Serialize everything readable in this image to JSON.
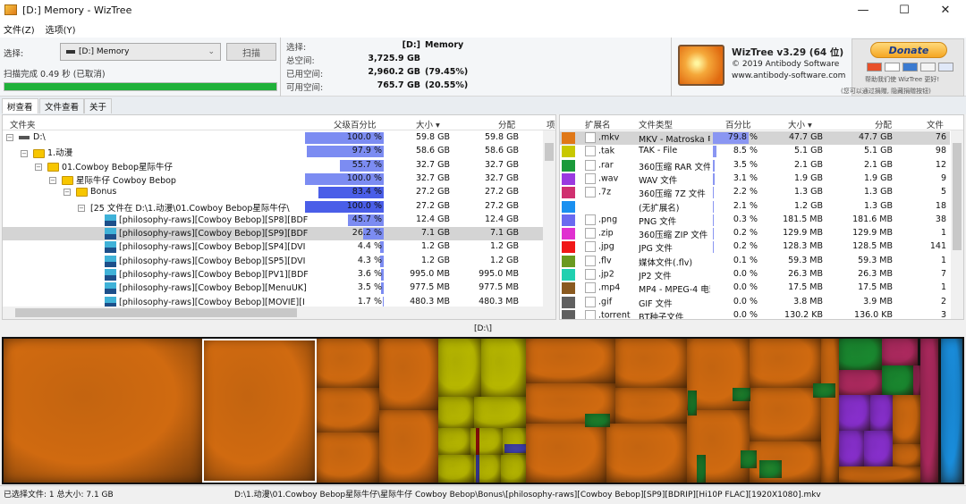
{
  "window": {
    "title": "[D:] Memory  - WizTree",
    "minimize": "—",
    "maximize": "☐",
    "close": "✕"
  },
  "menu": [
    {
      "label": "文件(Z)"
    },
    {
      "label": "选项(Y)"
    }
  ],
  "toolbar": {
    "select_label": "选择:",
    "drive_value": "[D:] Memory",
    "scan_label": "扫描",
    "scan_status": "扫描完成 0.49 秒 (已取消)",
    "progress_percent": 100,
    "progress_color": "#1fb13a"
  },
  "drive_info": {
    "select_label": "选择:",
    "select_value": "[D:]",
    "select_name": "Memory",
    "total_label": "总空间:",
    "total_value": "3,725.9 GB",
    "used_label": "已用空间:",
    "used_value": "2,960.2 GB",
    "used_pct": "(79.45%)",
    "free_label": "可用空间:",
    "free_value": "765.7 GB",
    "free_pct": "(20.55%)"
  },
  "about": {
    "title": "WizTree v3.29 (64 位)",
    "copyright": "© 2019 Antibody Software",
    "url": "www.antibody-software.com"
  },
  "donate": {
    "label": "Donate",
    "note1": "帮助我们使 WizTree 更好!",
    "note2": "(您可以通过捐赠, 隐藏捐赠按钮)"
  },
  "tabs": [
    {
      "label": "树查看",
      "active": true
    },
    {
      "label": "文件查看"
    },
    {
      "label": "关于"
    }
  ],
  "tree": {
    "headers": {
      "name": "文件夹",
      "pct": "父级百分比",
      "size": "大小 ▾",
      "alloc": "分配",
      "items": "项"
    },
    "rows": [
      {
        "name": "D:\\",
        "pct": "100.0 %",
        "pct_value": 100,
        "size": "59.8 GB",
        "alloc": "59.8 GB",
        "depth": 0,
        "icon": "drive-icon"
      },
      {
        "name": "1.动漫",
        "pct": "97.9 %",
        "pct_value": 97.9,
        "size": "58.6 GB",
        "alloc": "58.6 GB",
        "depth": 1,
        "icon": "folder-icon"
      },
      {
        "name": "01.Cowboy Bebop星际牛仔",
        "pct": "55.7 %",
        "pct_value": 55.7,
        "size": "32.7 GB",
        "alloc": "32.7 GB",
        "depth": 2,
        "icon": "folder-icon"
      },
      {
        "name": "星际牛仔 Cowboy Bebop",
        "pct": "100.0 %",
        "pct_value": 100,
        "size": "32.7 GB",
        "alloc": "32.7 GB",
        "depth": 3,
        "icon": "folder-icon"
      },
      {
        "name": "Bonus",
        "pct": "83.4 %",
        "pct_value": 83.4,
        "size": "27.2 GB",
        "alloc": "27.2 GB",
        "depth": 4,
        "icon": "folder-icon"
      },
      {
        "name": "[25 文件在 D:\\1.动漫\\01.Cowboy Bebop星际牛仔\\",
        "pct": "100.0 %",
        "pct_value": 100,
        "size": "27.2 GB",
        "alloc": "27.2 GB",
        "depth": 5,
        "icon": "none"
      },
      {
        "name": "[philosophy-raws][Cowboy Bebop][SP8][BDF",
        "pct": "45.7 %",
        "pct_value": 45.7,
        "size": "12.4 GB",
        "alloc": "12.4 GB",
        "depth": 6,
        "icon": "mkv-icon"
      },
      {
        "name": "[philosophy-raws][Cowboy Bebop][SP9][BDF",
        "pct": "26.2 %",
        "pct_value": 26.2,
        "size": "7.1 GB",
        "alloc": "7.1 GB",
        "depth": 6,
        "icon": "mkv-icon",
        "selected": true
      },
      {
        "name": "[philosophy-raws][Cowboy Bebop][SP4][DVI",
        "pct": "4.4 %",
        "pct_value": 4.4,
        "size": "1.2 GB",
        "alloc": "1.2 GB",
        "depth": 6,
        "icon": "mkv-icon"
      },
      {
        "name": "[philosophy-raws][Cowboy Bebop][SP5][DVI",
        "pct": "4.3 %",
        "pct_value": 4.3,
        "size": "1.2 GB",
        "alloc": "1.2 GB",
        "depth": 6,
        "icon": "mkv-icon"
      },
      {
        "name": "[philosophy-raws][Cowboy Bebop][PV1][BDF",
        "pct": "3.6 %",
        "pct_value": 3.6,
        "size": "995.0 MB",
        "alloc": "995.0 MB",
        "depth": 6,
        "icon": "mkv-icon"
      },
      {
        "name": "[philosophy-raws][Cowboy Bebop][MenuUK]",
        "pct": "3.5 %",
        "pct_value": 3.5,
        "size": "977.5 MB",
        "alloc": "977.5 MB",
        "depth": 6,
        "icon": "mkv-icon"
      },
      {
        "name": "[philosophy-raws][Cowboy Bebop][MOVIE][I",
        "pct": "1.7 %",
        "pct_value": 1.7,
        "size": "480.3 MB",
        "alloc": "480.3 MB",
        "depth": 6,
        "icon": "mkv-icon"
      }
    ]
  },
  "extensions": {
    "headers": {
      "ext": "扩展名",
      "type": "文件类型",
      "pct": "百分比",
      "size": "大小 ▾",
      "alloc": "分配",
      "files": "文件"
    },
    "rows": [
      {
        "color": "#e07818",
        "ext": ".mkv",
        "type": "MKV - Matroska 电",
        "pct": "79.8 %",
        "pct_value": 79.8,
        "size": "47.7 GB",
        "alloc": "47.7 GB",
        "files": "76",
        "selected": true
      },
      {
        "color": "#c8c800",
        "ext": ".tak",
        "type": "TAK - File",
        "pct": "8.5 %",
        "pct_value": 8.5,
        "size": "5.1 GB",
        "alloc": "5.1 GB",
        "files": "98"
      },
      {
        "color": "#1a9a3a",
        "ext": ".rar",
        "type": "360压缩 RAR 文件",
        "pct": "3.5 %",
        "pct_value": 3.5,
        "size": "2.1 GB",
        "alloc": "2.1 GB",
        "files": "12"
      },
      {
        "color": "#9a3ae0",
        "ext": ".wav",
        "type": "WAV 文件",
        "pct": "3.1 %",
        "pct_value": 3.1,
        "size": "1.9 GB",
        "alloc": "1.9 GB",
        "files": "9"
      },
      {
        "color": "#d03070",
        "ext": ".7z",
        "type": "360压缩 7Z 文件",
        "pct": "2.2 %",
        "pct_value": 2.2,
        "size": "1.3 GB",
        "alloc": "1.3 GB",
        "files": "5"
      },
      {
        "color": "#1a90f0",
        "ext": "",
        "type": "(无扩展名)",
        "pct": "2.1 %",
        "pct_value": 2.1,
        "size": "1.2 GB",
        "alloc": "1.3 GB",
        "files": "18"
      },
      {
        "color": "#6a6af0",
        "ext": ".png",
        "type": "PNG 文件",
        "pct": "0.3 %",
        "pct_value": 0.3,
        "size": "181.5 MB",
        "alloc": "181.6 MB",
        "files": "38"
      },
      {
        "color": "#e030d0",
        "ext": ".zip",
        "type": "360压缩 ZIP 文件",
        "pct": "0.2 %",
        "pct_value": 0.2,
        "size": "129.9 MB",
        "alloc": "129.9 MB",
        "files": "1"
      },
      {
        "color": "#f01818",
        "ext": ".jpg",
        "type": "JPG 文件",
        "pct": "0.2 %",
        "pct_value": 0.2,
        "size": "128.3 MB",
        "alloc": "128.5 MB",
        "files": "141"
      },
      {
        "color": "#6a9a20",
        "ext": ".flv",
        "type": "媒体文件(.flv)",
        "pct": "0.1 %",
        "pct_value": 0.1,
        "size": "59.3 MB",
        "alloc": "59.3 MB",
        "files": "1"
      },
      {
        "color": "#20d0b0",
        "ext": ".jp2",
        "type": "JP2 文件",
        "pct": "0.0 %",
        "pct_value": 0,
        "size": "26.3 MB",
        "alloc": "26.3 MB",
        "files": "7"
      },
      {
        "color": "#8a5a20",
        "ext": ".mp4",
        "type": "MP4 - MPEG-4 电影",
        "pct": "0.0 %",
        "pct_value": 0,
        "size": "17.5 MB",
        "alloc": "17.5 MB",
        "files": "1"
      },
      {
        "color": "#606060",
        "ext": ".gif",
        "type": "GIF 文件",
        "pct": "0.0 %",
        "pct_value": 0,
        "size": "3.8 MB",
        "alloc": "3.9 MB",
        "files": "2"
      },
      {
        "color": "#606060",
        "ext": ".torrent",
        "type": "BT种子文件",
        "pct": "0.0 %",
        "pct_value": 0,
        "size": "130.2 KB",
        "alloc": "136.0 KB",
        "files": "3"
      }
    ]
  },
  "treemap": {
    "label": "[D:\\]"
  },
  "status": {
    "selection": "已选择文件: 1  总大小: 7.1 GB",
    "path": "D:\\1.动漫\\01.Cowboy Bebop星际牛仔\\星际牛仔 Cowboy Bebop\\Bonus\\[philosophy-raws][Cowboy Bebop][SP9][BDRIP][Hi10P FLAC][1920X1080].mkv"
  }
}
